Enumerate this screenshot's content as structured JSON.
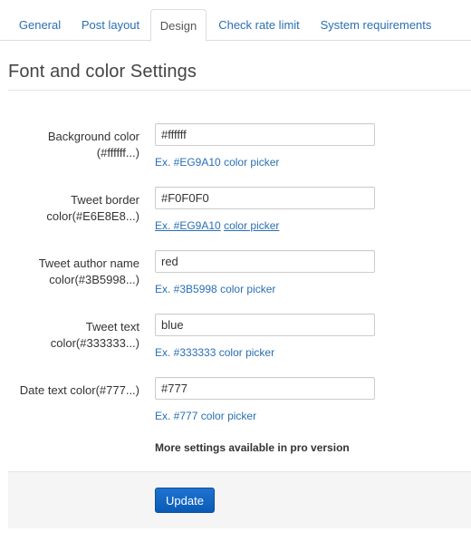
{
  "tabs": [
    {
      "label": "General",
      "active": false
    },
    {
      "label": "Post layout",
      "active": false
    },
    {
      "label": "Design",
      "active": true
    },
    {
      "label": "Check rate limit",
      "active": false
    },
    {
      "label": "System requirements",
      "active": false
    }
  ],
  "heading": "Font and color Settings",
  "fields": [
    {
      "label": "Background color (#ffffff...)",
      "value": "#ffffff",
      "hint_ex": "Ex. #EG9A10",
      "hint_link": "color picker"
    },
    {
      "label": "Tweet border color(#E6E8E8...)",
      "value": "#F0F0F0",
      "hint_ex": "Ex. #EG9A10",
      "hint_link": "color picker"
    },
    {
      "label": "Tweet author name color(#3B5998...)",
      "value": "red",
      "hint_ex": "Ex. #3B5998",
      "hint_link": "color picker"
    },
    {
      "label": "Tweet text color(#333333...)",
      "value": "blue",
      "hint_ex": "Ex. #333333",
      "hint_link": "color picker"
    },
    {
      "label": "Date text color(#777...)",
      "value": "#777",
      "hint_ex": "Ex. #777",
      "hint_link": "color picker"
    }
  ],
  "pro_note": "More settings available in pro version",
  "update_label": "Update",
  "colors": {
    "link": "#2a6fb3",
    "button": "#0a5bb5",
    "footer_bg": "#f5f5f5"
  }
}
